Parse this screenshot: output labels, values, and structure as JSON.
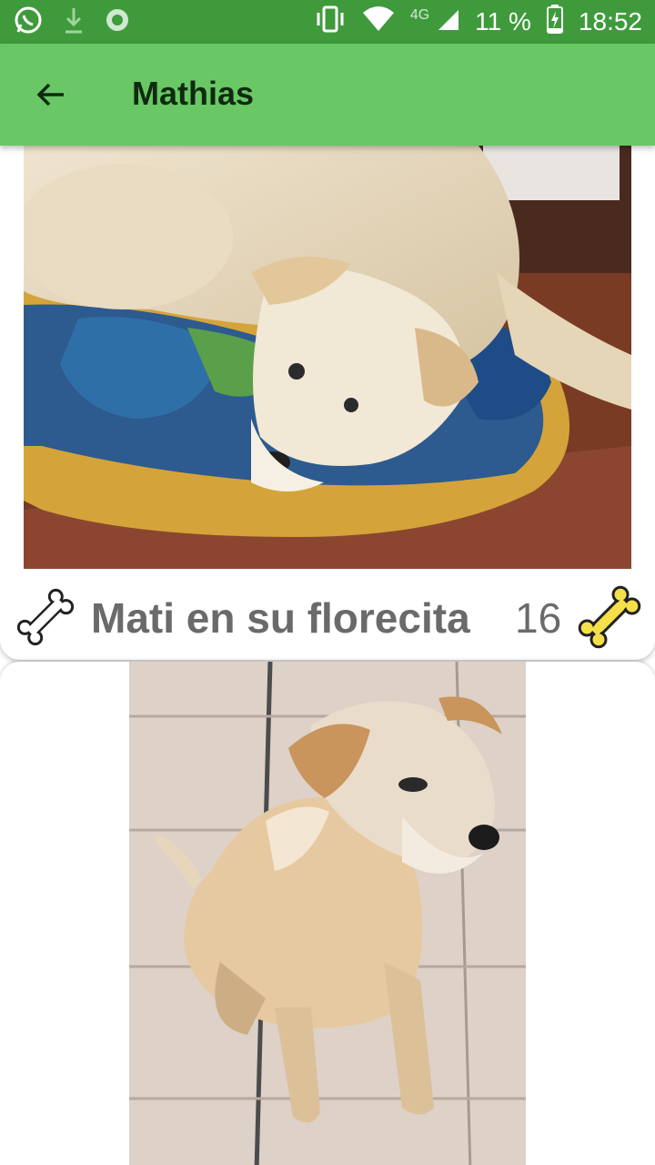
{
  "status_bar": {
    "network": "4G",
    "battery": "11 %",
    "time": "18:52",
    "icons": [
      "whatsapp-icon",
      "download-icon",
      "sync-icon",
      "vibrate-icon",
      "wifi-icon",
      "signal-icon",
      "battery-charging-icon"
    ]
  },
  "app_bar": {
    "title": "Mathias",
    "back_icon": "arrow-back-icon",
    "color": "#69c765"
  },
  "posts": [
    {
      "caption": "Mati en su florecita",
      "likes": "16",
      "like_icon": "bone-icon",
      "liked_color": "#f5e04a"
    }
  ]
}
